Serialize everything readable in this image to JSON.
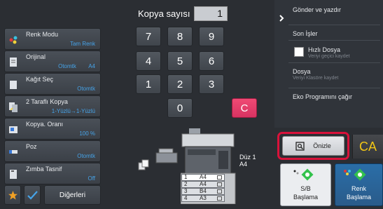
{
  "keypad": {
    "count_label": "Kopya sayısı",
    "count_value": "1",
    "keys": [
      "7",
      "8",
      "9",
      "4",
      "5",
      "6",
      "1",
      "2",
      "3",
      "0"
    ],
    "clear_label": "C"
  },
  "functions": [
    {
      "label": "Renk Modu",
      "value": "Tam Renk",
      "icon": "color-mode-icon"
    },
    {
      "label": "Orijinal",
      "value": "Otomtk        A4",
      "icon": "original-icon"
    },
    {
      "label": "Kağıt Seç",
      "value": "Otomtk",
      "icon": "paper-select-icon"
    },
    {
      "label": "2 Taraflı Kopya",
      "value": "1-Yüzlü→1-Yüzlü",
      "icon": "duplex-copy-icon"
    },
    {
      "label": "Kopya. Oranı",
      "value": "100 %",
      "icon": "copy-ratio-icon"
    },
    {
      "label": "Poz",
      "value": "Otomtk",
      "icon": "exposure-icon"
    },
    {
      "label": "Zımba Tasnif",
      "value": "Off",
      "icon": "staple-sort-icon"
    }
  ],
  "bottom_bar": {
    "others_label": "Diğerleri"
  },
  "right_panel": {
    "send_print": "Gönder ve yazdır",
    "recent_jobs": "Son İşler",
    "quick_file": "Hızlı Dosya",
    "quick_file_sub": "Veriyi geçici kaydet",
    "file": "Dosya",
    "file_sub": "Veriyi Klasöre kaydet",
    "eco_program": "Eko Programını çağır"
  },
  "machine": {
    "duplex_label": "Düz 1",
    "duplex_size": "A4",
    "trays": [
      {
        "num": "1",
        "size": "A4"
      },
      {
        "num": "2",
        "size": "A4"
      },
      {
        "num": "3",
        "size": "B4"
      },
      {
        "num": "4",
        "size": "A3"
      }
    ]
  },
  "actions": {
    "preview_label": "Önizle",
    "ca_label": "CA",
    "bw_start_line1": "S/B",
    "bw_start_line2": "Başlama",
    "color_start_line1": "Renk",
    "color_start_line2": "Başlama"
  },
  "colors": {
    "accent_blue": "#46a3e8",
    "clear_pink": "#e23b68",
    "ca_yellow": "#f2c615",
    "highlight_red": "#d8123a",
    "start_green": "#33c24d"
  }
}
